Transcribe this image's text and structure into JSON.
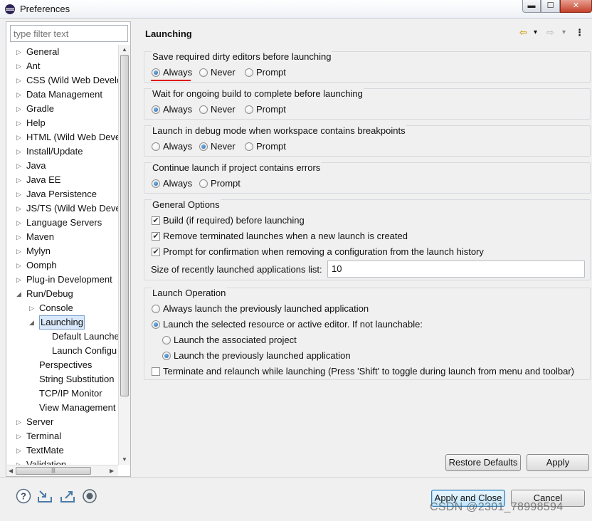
{
  "window": {
    "title": "Preferences",
    "buttons": {
      "minimize": "▬",
      "maximize": "☐",
      "close": "✕"
    }
  },
  "filter": {
    "placeholder": "type filter text"
  },
  "tree": {
    "items": [
      {
        "label": "General",
        "level": 0,
        "expanded": false
      },
      {
        "label": "Ant",
        "level": 0,
        "expanded": false
      },
      {
        "label": "CSS (Wild Web Develo",
        "level": 0,
        "expanded": false
      },
      {
        "label": "Data Management",
        "level": 0,
        "expanded": false
      },
      {
        "label": "Gradle",
        "level": 0,
        "expanded": false
      },
      {
        "label": "Help",
        "level": 0,
        "expanded": false
      },
      {
        "label": "HTML (Wild Web Deve",
        "level": 0,
        "expanded": false
      },
      {
        "label": "Install/Update",
        "level": 0,
        "expanded": false
      },
      {
        "label": "Java",
        "level": 0,
        "expanded": false
      },
      {
        "label": "Java EE",
        "level": 0,
        "expanded": false
      },
      {
        "label": "Java Persistence",
        "level": 0,
        "expanded": false
      },
      {
        "label": "JS/TS (Wild Web Deve",
        "level": 0,
        "expanded": false
      },
      {
        "label": "Language Servers",
        "level": 0,
        "expanded": false
      },
      {
        "label": "Maven",
        "level": 0,
        "expanded": false
      },
      {
        "label": "Mylyn",
        "level": 0,
        "expanded": false
      },
      {
        "label": "Oomph",
        "level": 0,
        "expanded": false
      },
      {
        "label": "Plug-in Development",
        "level": 0,
        "expanded": false
      },
      {
        "label": "Run/Debug",
        "level": 0,
        "expanded": true
      },
      {
        "label": "Console",
        "level": 1,
        "expanded": false
      },
      {
        "label": "Launching",
        "level": 1,
        "expanded": true,
        "selected": true
      },
      {
        "label": "Default Launche",
        "level": 2,
        "leaf": true
      },
      {
        "label": "Launch Configu",
        "level": 2,
        "leaf": true
      },
      {
        "label": "Perspectives",
        "level": 1,
        "leaf": true
      },
      {
        "label": "String Substitution",
        "level": 1,
        "leaf": true
      },
      {
        "label": "TCP/IP Monitor",
        "level": 1,
        "leaf": true
      },
      {
        "label": "View Management",
        "level": 1,
        "leaf": true
      },
      {
        "label": "Server",
        "level": 0,
        "expanded": false
      },
      {
        "label": "Terminal",
        "level": 0,
        "expanded": false
      },
      {
        "label": "TextMate",
        "level": 0,
        "expanded": false
      },
      {
        "label": "Validation",
        "level": 0,
        "expanded": false
      }
    ]
  },
  "page": {
    "title": "Launching",
    "nav": {
      "back": "⇦",
      "back_menu": "▾",
      "forward": "⇨",
      "forward_menu": "▾",
      "menu": "⋮"
    }
  },
  "groups": {
    "dirty": {
      "label": "Save required dirty editors before launching",
      "options": [
        "Always",
        "Never",
        "Prompt"
      ],
      "selected": "Always"
    },
    "build": {
      "label": "Wait for ongoing build to complete before launching",
      "options": [
        "Always",
        "Never",
        "Prompt"
      ],
      "selected": "Always"
    },
    "debug": {
      "label": "Launch in debug mode when workspace contains breakpoints",
      "options": [
        "Always",
        "Never",
        "Prompt"
      ],
      "selected": "Never"
    },
    "errors": {
      "label": "Continue launch if project contains errors",
      "options": [
        "Always",
        "Prompt"
      ],
      "selected": "Always"
    },
    "general": {
      "label": "General Options",
      "checks": [
        {
          "label": "Build (if required) before launching",
          "checked": true
        },
        {
          "label": "Remove terminated launches when a new launch is created",
          "checked": true
        },
        {
          "label": "Prompt for confirmation when removing a configuration from the launch history",
          "checked": true
        }
      ],
      "size_label": "Size of recently launched applications list:",
      "size_value": "10"
    },
    "operation": {
      "label": "Launch Operation",
      "always_previous": "Always launch the previously launched application",
      "launch_selected": "Launch the selected resource or active editor. If not launchable:",
      "launch_associated": "Launch the associated project",
      "launch_previous": "Launch the previously launched application",
      "terminate": "Terminate and relaunch while launching (Press 'Shift' to toggle during launch from menu and toolbar)",
      "selected_main": "launch_selected",
      "selected_sub": "launch_previous",
      "terminate_checked": false
    }
  },
  "buttons": {
    "restore_defaults": "Restore Defaults",
    "apply": "Apply",
    "apply_close": "Apply and Close",
    "cancel": "Cancel"
  },
  "watermark": "CSDN @2301_78998594"
}
